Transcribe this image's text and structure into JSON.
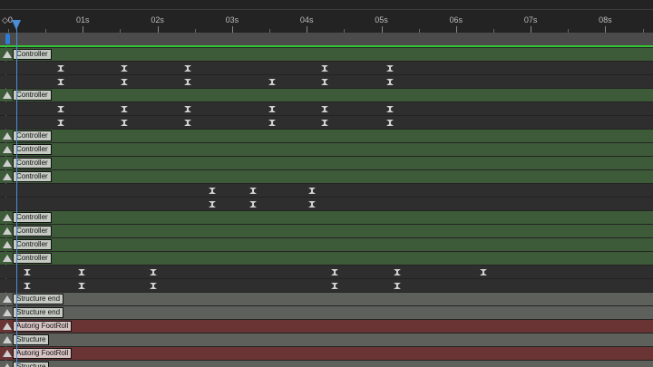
{
  "ruler": {
    "start_label": "◇0",
    "ticks": [
      {
        "label": "01s",
        "time": 1
      },
      {
        "label": "02s",
        "time": 2
      },
      {
        "label": "03s",
        "time": 3
      },
      {
        "label": "04s",
        "time": 4
      },
      {
        "label": "05s",
        "time": 5
      },
      {
        "label": "06s",
        "time": 6
      },
      {
        "label": "07s",
        "time": 7
      },
      {
        "label": "08s",
        "time": 8
      }
    ]
  },
  "timeline": {
    "playhead_time": 0.0,
    "work_area_start": 0.0
  },
  "tracks": [
    {
      "type": "bar",
      "color": "green",
      "label": "Controller"
    },
    {
      "type": "key",
      "keys": [
        -0.12,
        0.73,
        1.58,
        3.41,
        4.29
      ]
    },
    {
      "type": "key",
      "keys": [
        -0.12,
        0.73,
        1.58,
        2.71,
        3.41,
        4.29
      ]
    },
    {
      "type": "bar",
      "color": "green",
      "label": "Controller"
    },
    {
      "type": "key",
      "keys": [
        -0.12,
        0.73,
        1.58,
        2.71,
        3.41,
        4.29
      ]
    },
    {
      "type": "key",
      "keys": [
        -0.12,
        0.73,
        1.58,
        2.71,
        3.41,
        4.29
      ]
    },
    {
      "type": "bar",
      "color": "green",
      "label": "Controller"
    },
    {
      "type": "bar",
      "color": "green",
      "label": "Controller"
    },
    {
      "type": "bar",
      "color": "green",
      "label": "Controller"
    },
    {
      "type": "bar",
      "color": "green",
      "label": "Controller"
    },
    {
      "type": "key",
      "keys": [
        1.9,
        2.45,
        3.24
      ]
    },
    {
      "type": "key",
      "keys": [
        1.9,
        2.45,
        3.24
      ]
    },
    {
      "type": "bar",
      "color": "green",
      "label": "Controller"
    },
    {
      "type": "bar",
      "color": "green",
      "label": "Controller"
    },
    {
      "type": "bar",
      "color": "green",
      "label": "Controller"
    },
    {
      "type": "bar",
      "color": "green",
      "label": "Controller"
    },
    {
      "type": "key",
      "keys": [
        -0.58,
        0.16,
        1.12,
        3.54,
        4.38,
        5.54
      ]
    },
    {
      "type": "key",
      "keys": [
        -0.58,
        0.16,
        1.12,
        3.54,
        4.38
      ]
    },
    {
      "type": "bar",
      "color": "gray",
      "label": "Structure end"
    },
    {
      "type": "bar",
      "color": "gray",
      "label": "Structure end"
    },
    {
      "type": "bar",
      "color": "red",
      "label": "Autorig FootRoll"
    },
    {
      "type": "bar",
      "color": "gray",
      "label": "Structure"
    },
    {
      "type": "bar",
      "color": "red",
      "label": "Autorig FootRoll"
    },
    {
      "type": "bar",
      "color": "gray",
      "label": "Structure"
    }
  ]
}
